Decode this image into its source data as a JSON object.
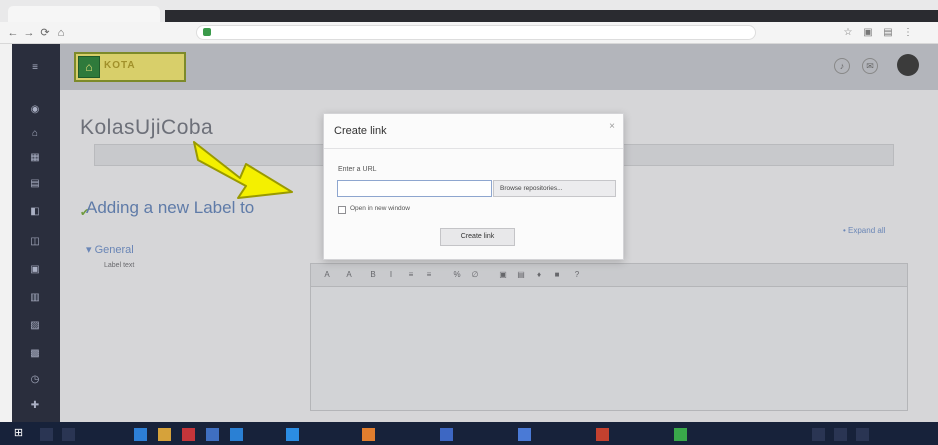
{
  "browser": {
    "tab_title": "",
    "url": "",
    "nav_back": "←",
    "nav_forward": "→",
    "nav_reload": "⟳",
    "nav_home": "⌂"
  },
  "site": {
    "logo_mark": "⌂",
    "logo_text": "KOTA",
    "nav_links": "",
    "avatar": ""
  },
  "page": {
    "title": "KolasUjiCoba",
    "strip_tabs": [
      "",
      "",
      ""
    ],
    "sub_heading": "Adding a new Label to",
    "sub_check": "✔",
    "collapse_all": "• Expand all",
    "general_link": "▾ General",
    "label_text_lbl": "Label text",
    "editor_buttons": [
      "A",
      "A",
      "B",
      "I",
      "≡",
      "≡",
      "%",
      "∅",
      "▣",
      "▤",
      "♦",
      "■",
      "?"
    ],
    "editor_content": ""
  },
  "modal": {
    "title": "Create link",
    "close": "×",
    "url_label": "Enter a URL",
    "url_value": "",
    "browse_label": "Browse repositories...",
    "newwin_label": "Open in new window",
    "create_label": "Create link"
  },
  "taskbar": {
    "start": "⊞",
    "items": [
      "",
      "",
      "",
      "",
      "",
      ""
    ],
    "clock_time": "",
    "clock_date": ""
  },
  "colors": {
    "accent": "#5f7ba8",
    "arrow_fill": "#f4f000",
    "arrow_stroke": "#9a9a00"
  }
}
